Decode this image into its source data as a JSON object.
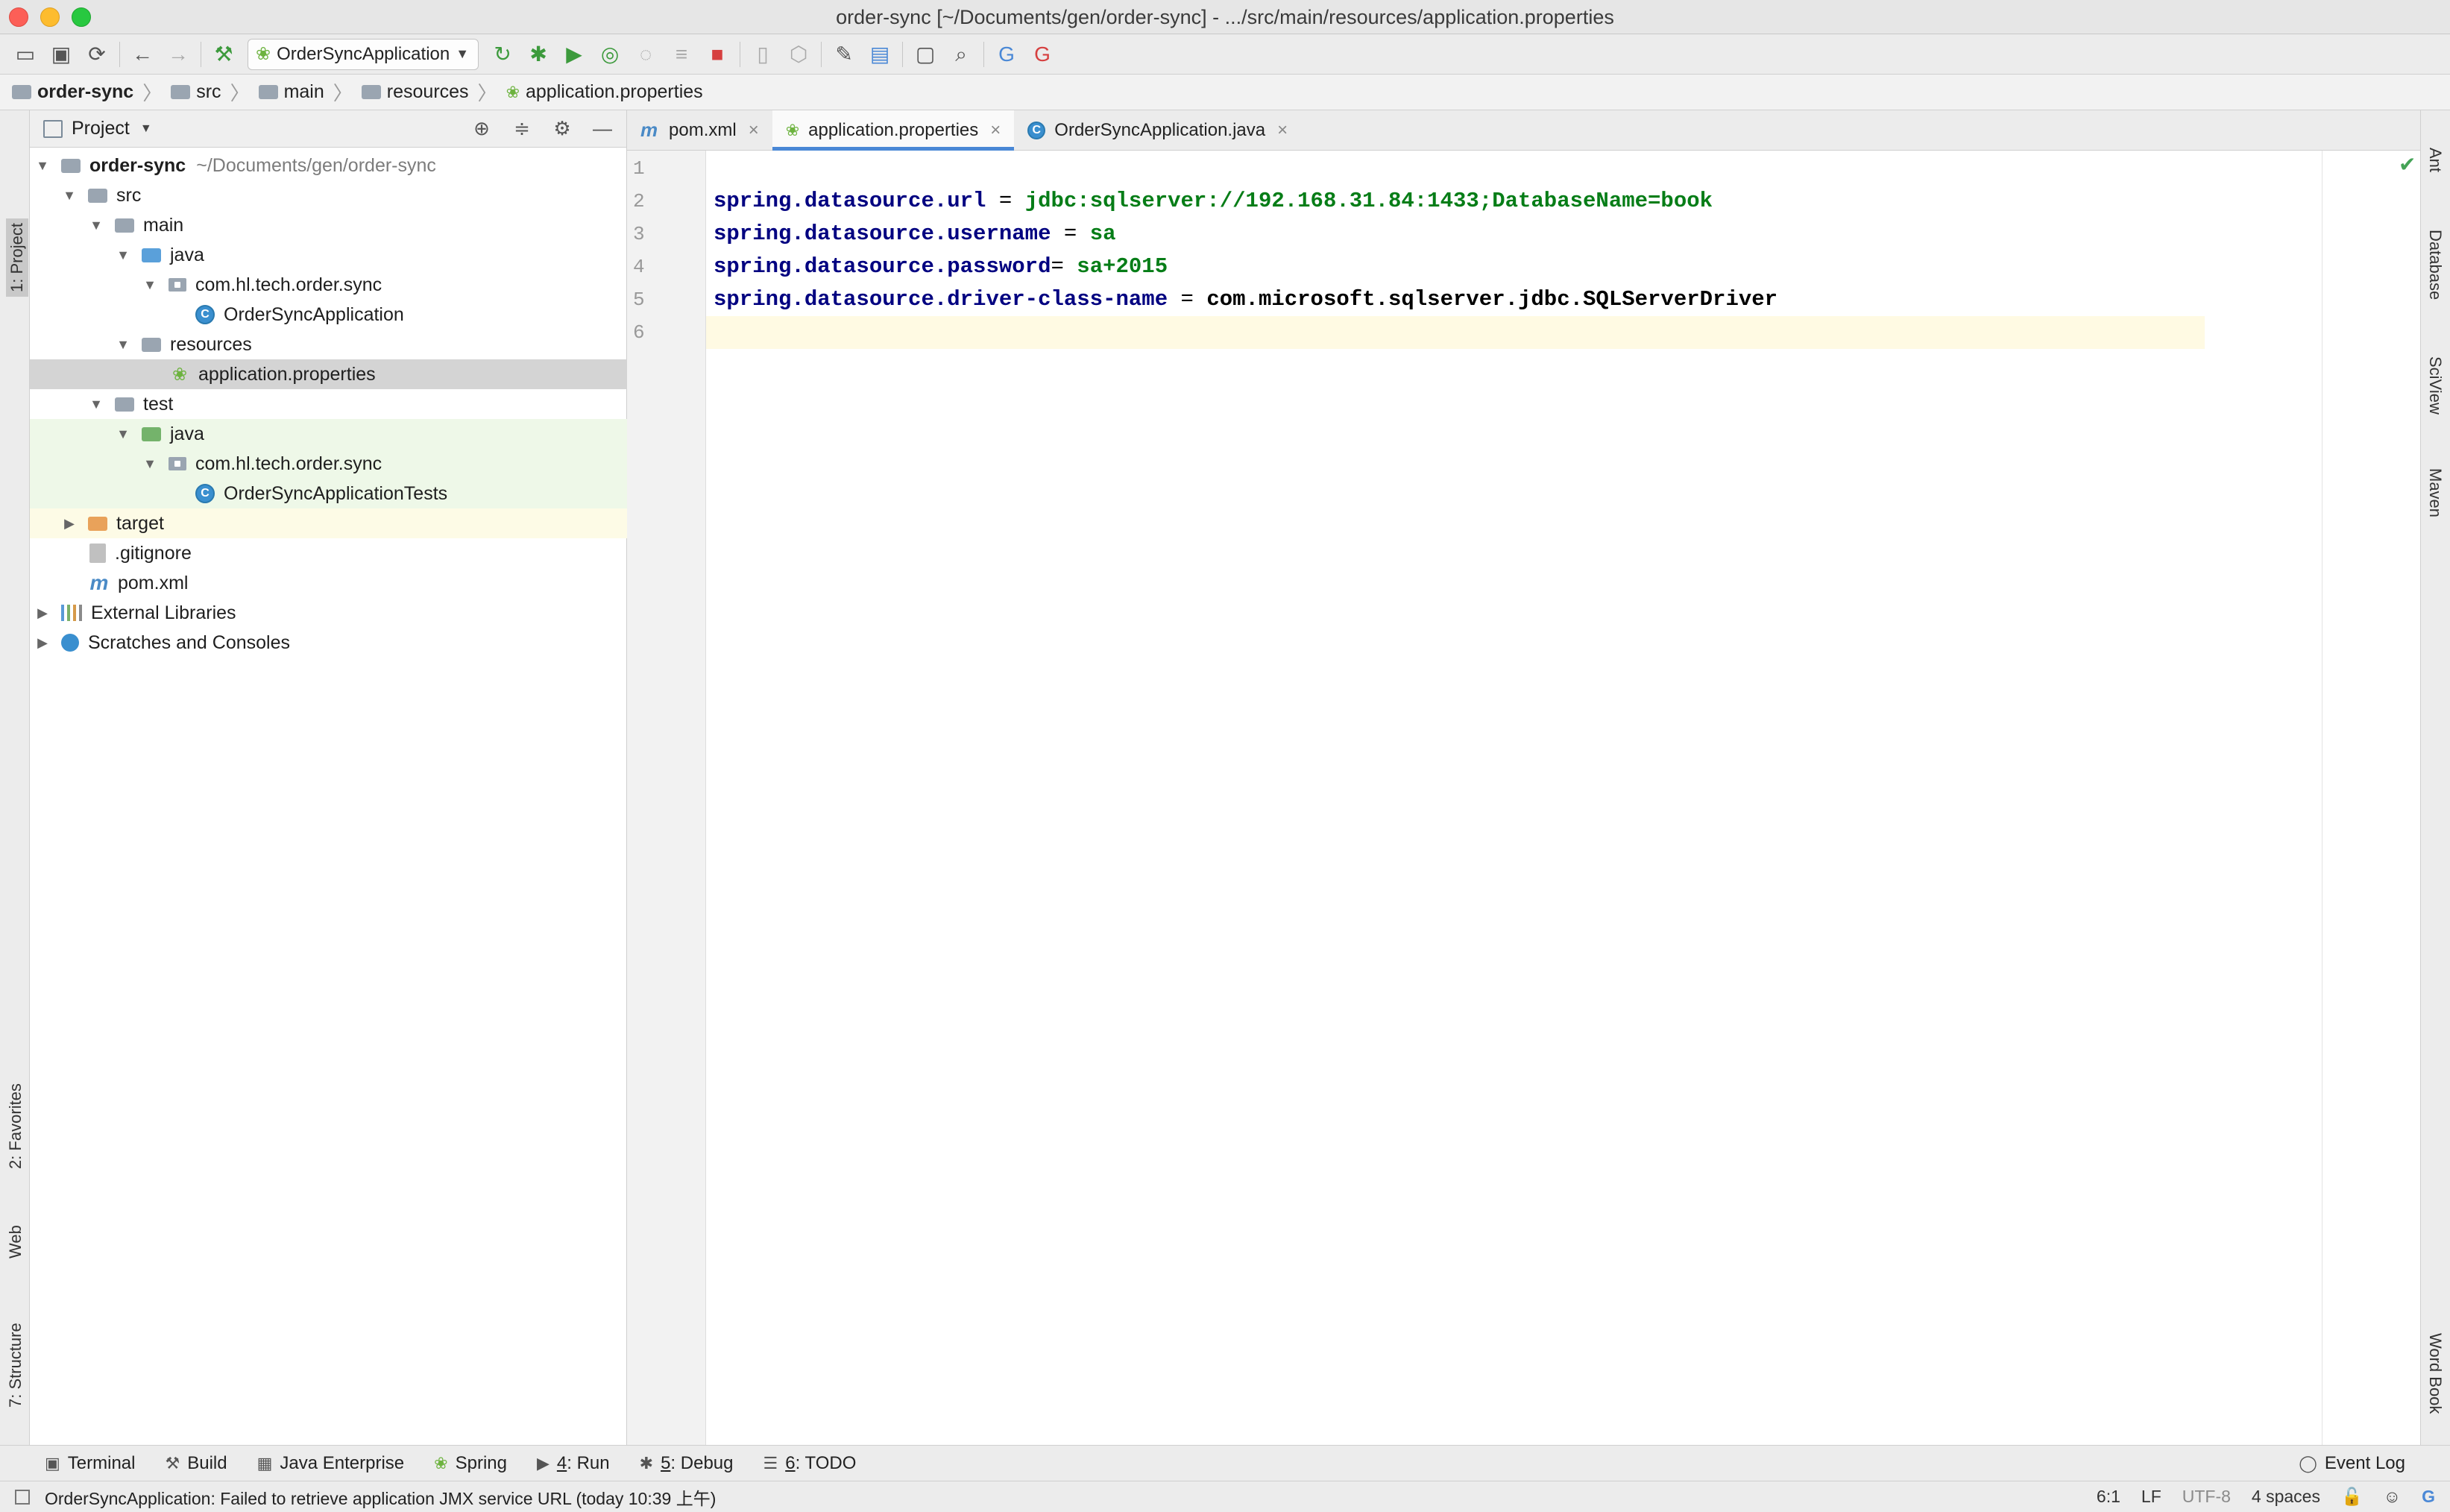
{
  "window": {
    "title": "order-sync [~/Documents/gen/order-sync] - .../src/main/resources/application.properties"
  },
  "toolbar": {
    "run_config": "OrderSyncApplication"
  },
  "breadcrumb": [
    "order-sync",
    "src",
    "main",
    "resources",
    "application.properties"
  ],
  "left_tool_tabs": {
    "project": "1: Project",
    "favorites": "2: Favorites",
    "web": "Web",
    "structure": "7: Structure"
  },
  "right_tool_tabs": {
    "ant": "Ant",
    "database": "Database",
    "sciview": "SciView",
    "maven": "Maven",
    "wordbook": "Word Book"
  },
  "project_panel": {
    "title": "Project",
    "root": {
      "name": "order-sync",
      "path": "~/Documents/gen/order-sync"
    },
    "items": [
      "src",
      "main",
      "java",
      "com.hl.tech.order.sync",
      "OrderSyncApplication",
      "resources",
      "application.properties",
      "test",
      "java",
      "com.hl.tech.order.sync",
      "OrderSyncApplicationTests",
      "target",
      ".gitignore",
      "pom.xml",
      "External Libraries",
      "Scratches and Consoles"
    ]
  },
  "editor_tabs": [
    "pom.xml",
    "application.properties",
    "OrderSyncApplication.java"
  ],
  "editor": {
    "line_numbers": [
      "1",
      "2",
      "3",
      "4",
      "5",
      "6"
    ],
    "lines": [
      {
        "key": "spring.datasource.url",
        "sep": " = ",
        "value": "jdbc:sqlserver://192.168.31.84:1433;DatabaseName=book"
      },
      {
        "key": "spring.datasource.username",
        "sep": " = ",
        "value": "sa"
      },
      {
        "key": "spring.datasource.password",
        "sep": "= ",
        "value": "sa+2015"
      },
      {
        "key": "spring.datasource.driver-class-name",
        "sep": " = ",
        "value": "com.microsoft.sqlserver.jdbc.SQLServerDriver"
      }
    ]
  },
  "bottom_tabs": {
    "terminal": "Terminal",
    "build": "Build",
    "java_enterprise": "Java Enterprise",
    "spring": "Spring",
    "run_num": "4",
    "run": ": Run",
    "debug_num": "5",
    "debug": ": Debug",
    "todo_num": "6",
    "todo": ": TODO",
    "event_log": "Event Log"
  },
  "status": {
    "message": "OrderSyncApplication: Failed to retrieve application JMX service URL (today 10:39 上午)",
    "position": "6:1",
    "line_sep": "LF",
    "encoding": "UTF-8",
    "indent": "4 spaces"
  },
  "colors": {
    "key": "#000080",
    "value": "#067d17",
    "accent": "#4a88d6",
    "selection": "#d4d4d4",
    "test_bg": "#eef8e8"
  }
}
